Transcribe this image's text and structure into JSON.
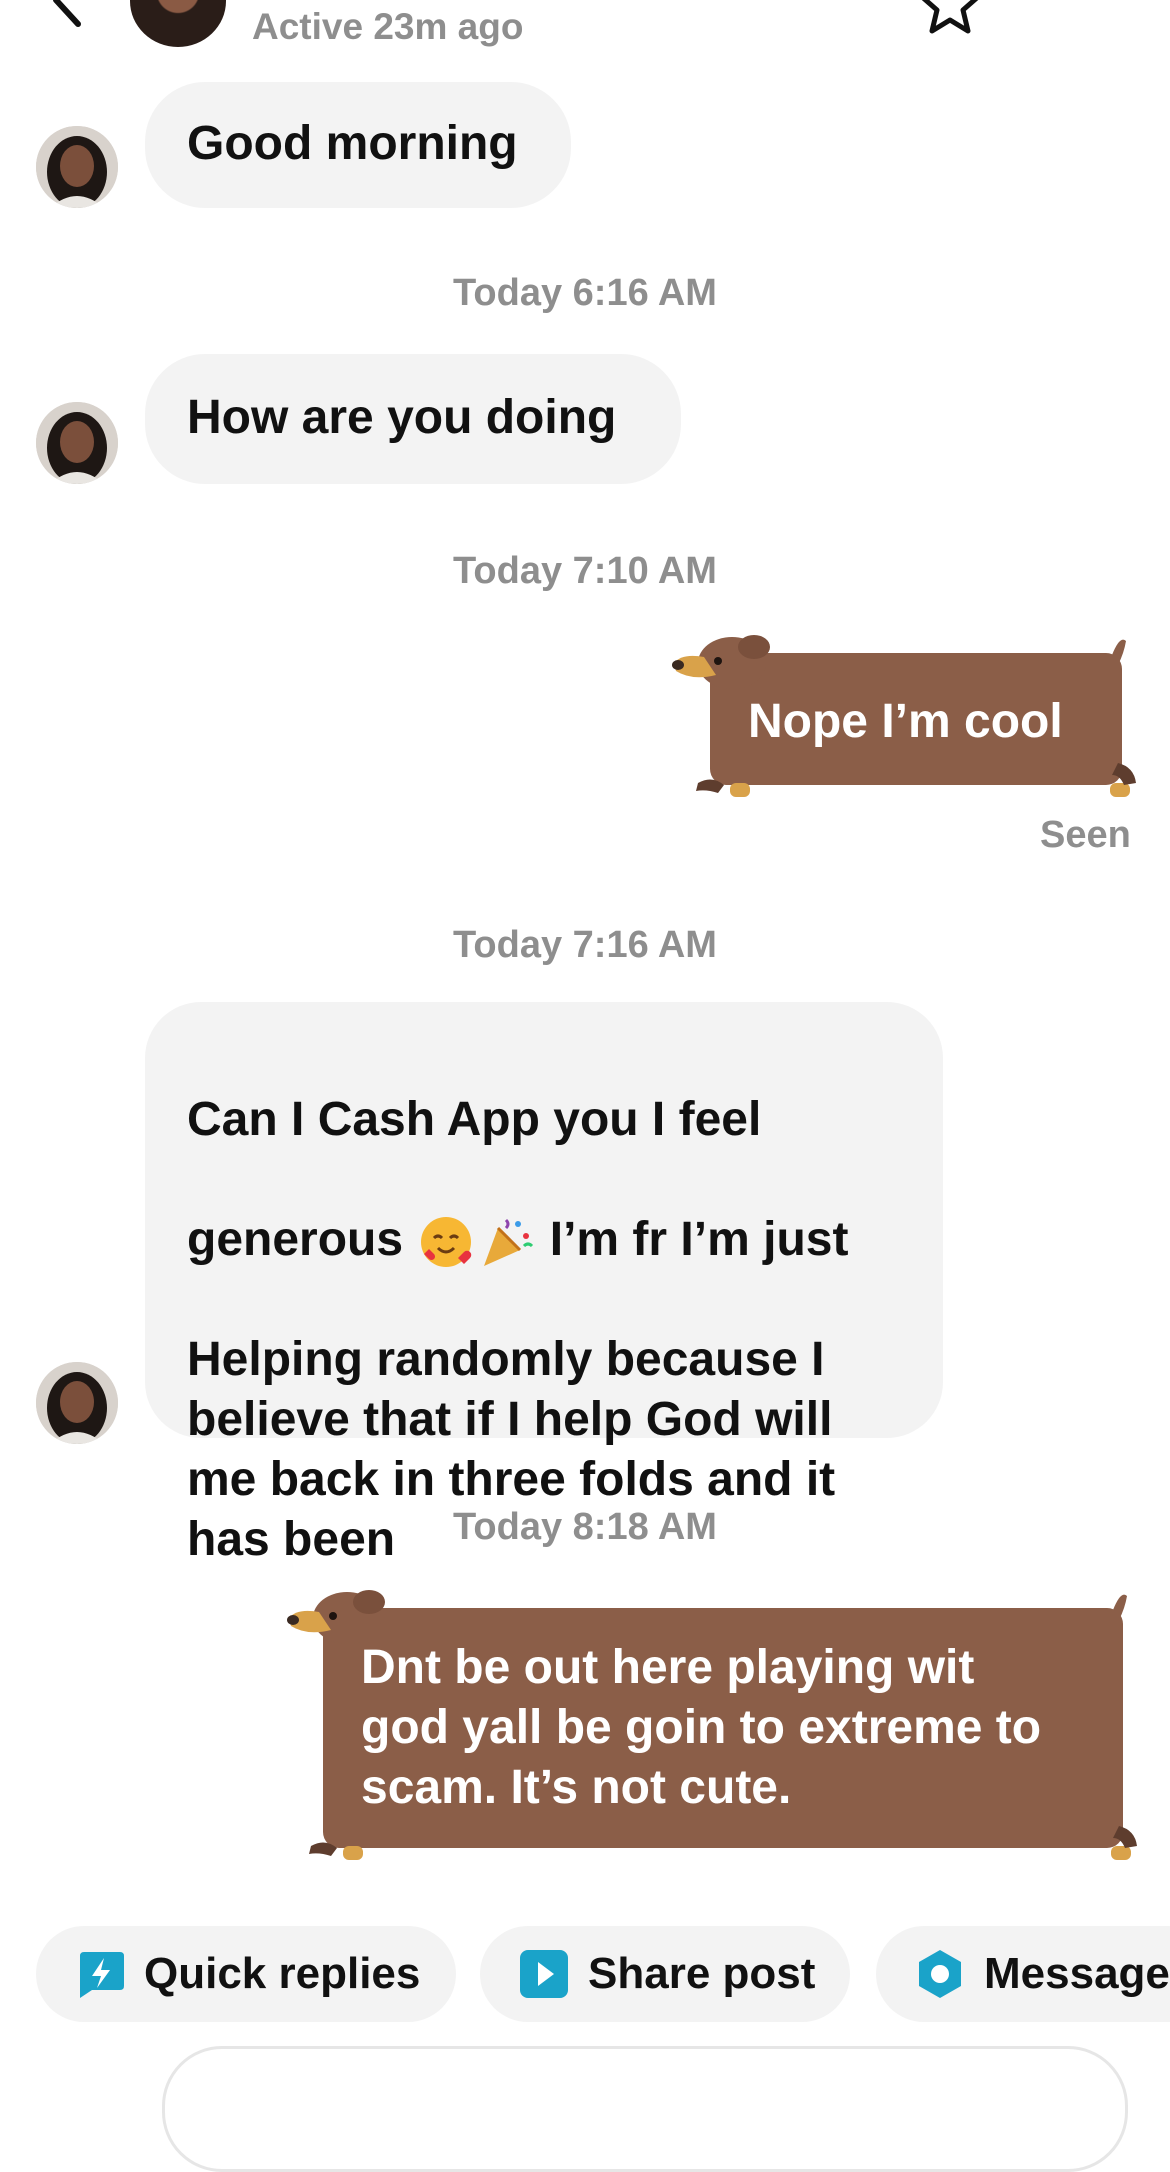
{
  "header": {
    "status": "Active 23m ago"
  },
  "messages": {
    "m1": "Good morning",
    "ts1": "Today 6:16 AM",
    "m2": "How are you doing",
    "ts2": "Today 7:10 AM",
    "m3": "Nope I’m cool",
    "seen": "Seen",
    "ts3": "Today 7:16 AM",
    "m4_line1": "Can I Cash App you  I feel",
    "m4_line2a": "generous",
    "m4_line2b": " I’m fr  I’m just",
    "m4_rest": "Helping randomly because I\nbelieve that if I help God will\nme back in three folds and it\nhas been",
    "ts4": "Today 8:18 AM",
    "m5": "Dnt be out here playing wit\ngod yall be goin to extreme to\nscam. It’s not cute."
  },
  "actions": {
    "quick_replies": "Quick replies",
    "share_post": "Share post",
    "message": "Message"
  },
  "colors": {
    "bubble_in": "#f3f3f3",
    "dog_body": "#8b5e48",
    "accent_blue": "#1aa3c9",
    "meta_gray": "#8e8e8e"
  },
  "icons": [
    "back-icon",
    "star-icon",
    "more-icon",
    "smiling-face-with-hearts-emoji",
    "party-popper-emoji",
    "quick-replies-icon",
    "share-post-icon",
    "message-icon"
  ]
}
